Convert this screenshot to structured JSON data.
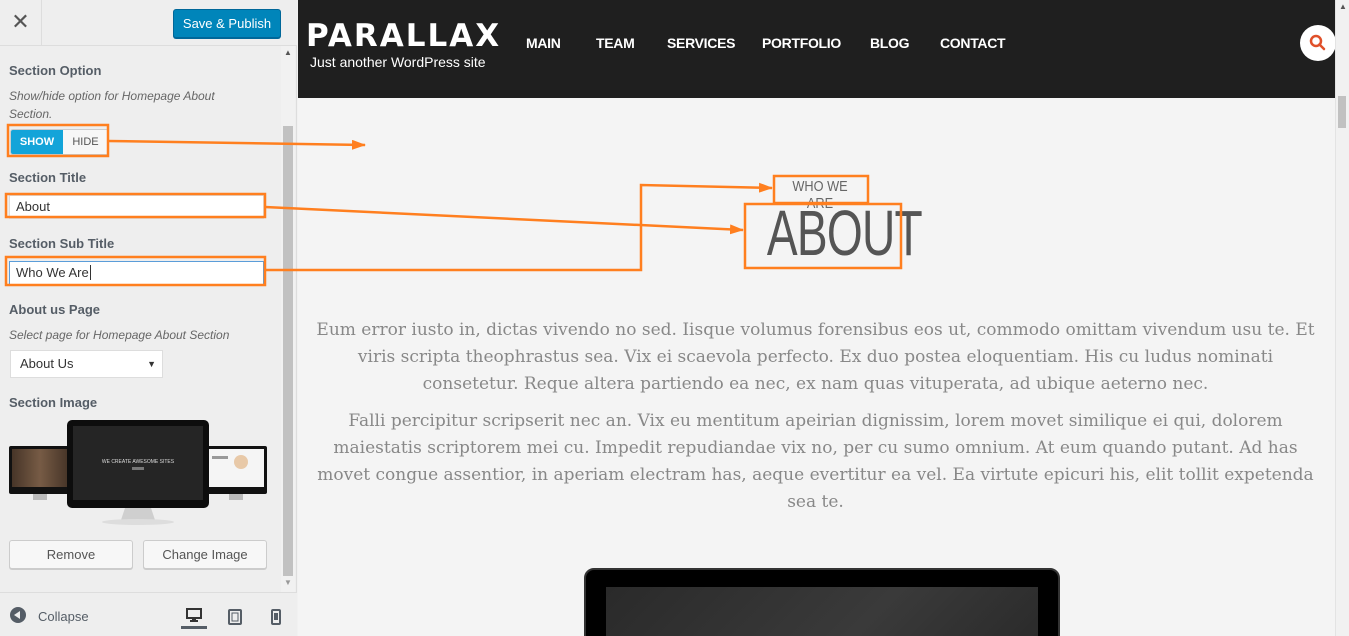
{
  "sidebar": {
    "save_label": "Save & Publish",
    "section_option": {
      "label": "Section Option",
      "description": "Show/hide option for Homepage About Section.",
      "show_label": "SHOW",
      "hide_label": "HIDE",
      "selected": "SHOW"
    },
    "section_title": {
      "label": "Section Title",
      "value": "About"
    },
    "section_sub_title": {
      "label": "Section Sub Title",
      "value": "Who We Are"
    },
    "about_page": {
      "label": "About us Page",
      "description": "Select page for Homepage About Section",
      "selected": "About Us"
    },
    "section_image": {
      "label": "Section Image",
      "preview_text": "WE CREATE AWESOME SITES",
      "remove_label": "Remove",
      "change_label": "Change Image"
    },
    "footer": {
      "collapse_label": "Collapse"
    }
  },
  "preview": {
    "site_title": "PARALLAX",
    "site_tagline": "Just another WordPress site",
    "nav": [
      "MAIN",
      "TEAM",
      "SERVICES",
      "PORTFOLIO",
      "BLOG",
      "CONTACT"
    ],
    "section_subtitle": "WHO WE ARE",
    "section_title": "ABOUT",
    "paragraphs": [
      "Eum error iusto in, dictas vivendo no sed. Iisque volumus forensibus eos ut, commodo omittam vivendum usu te. Et viris scripta theophrastus sea. Vix ei scaevola perfecto. Ex duo postea eloquentiam. His cu ludus nominati consetetur. Reque altera partiendo ea nec, ex nam quas vituperata, ad ubique aeterno nec.",
      "Falli percipitur scripserit nec an. Vix eu mentitum apeirian dignissim, lorem movet similique ei qui, dolorem maiestatis scriptorem mei cu. Impedit repudiandae vix no, per cu sumo omnium. At eum quando putant. Ad has movet congue assentior, in aperiam electram has, aeque evertitur ea vel. Ea virtute epicuri his, elit tollit expetenda sea te."
    ]
  },
  "colors": {
    "annotation": "#ff7f1f",
    "primary_button": "#0085ba",
    "toggle_active": "#13a4d9",
    "header_bg": "#1f1f1f",
    "search_icon": "#e0502a"
  }
}
